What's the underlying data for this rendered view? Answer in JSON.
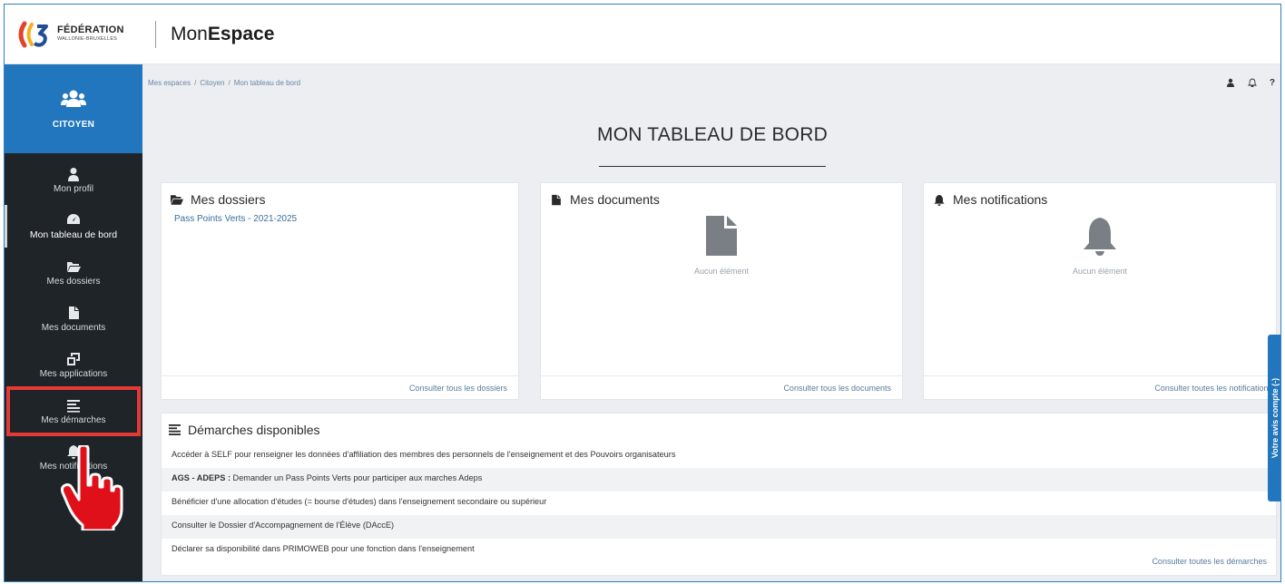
{
  "header": {
    "logo_line1": "FÉDÉRATION",
    "logo_line2": "WALLONIE-BRUXELLES",
    "app_title_light": "Mon",
    "app_title_bold": "Espace"
  },
  "sidebar": {
    "profile_label": "CITOYEN",
    "items": [
      {
        "label": "Mon profil",
        "icon": "user-icon"
      },
      {
        "label": "Mon tableau de bord",
        "icon": "dashboard-icon",
        "active": true
      },
      {
        "label": "Mes dossiers",
        "icon": "folder-icon"
      },
      {
        "label": "Mes documents",
        "icon": "document-icon"
      },
      {
        "label": "Mes applications",
        "icon": "windows-icon"
      },
      {
        "label": "Mes démarches",
        "icon": "list-icon",
        "highlighted": true
      },
      {
        "label": "Mes notifications",
        "icon": "bell-icon"
      }
    ]
  },
  "breadcrumb": [
    "Mes espaces",
    "Citoyen",
    "Mon tableau de bord"
  ],
  "topbar": {
    "help": "?"
  },
  "page_title": "MON TABLEAU DE BORD",
  "cards": {
    "dossiers": {
      "title": "Mes dossiers",
      "items": [
        "Pass Points Verts - 2021-2025"
      ],
      "footer": "Consulter tous les dossiers"
    },
    "documents": {
      "title": "Mes documents",
      "empty": "Aucun élément",
      "footer": "Consulter tous les documents"
    },
    "notifications": {
      "title": "Mes notifications",
      "empty": "Aucun élément",
      "footer": "Consulter toutes les notifications"
    }
  },
  "demarches": {
    "title": "Démarches disponibles",
    "rows": [
      {
        "bold": "",
        "text": "Accéder à SELF pour renseigner les données d'affiliation des membres des personnels de l'enseignement et des Pouvoirs organisateurs"
      },
      {
        "bold": "AGS - ADEPS :",
        "text": " Demander un Pass Points Verts pour participer aux marches Adeps"
      },
      {
        "bold": "",
        "text": "Bénéficier d'une allocation d'études (= bourse d'études) dans l'enseignement secondaire ou supérieur"
      },
      {
        "bold": "",
        "text": "Consulter le Dossier d'Accompagnement de l'Élève (DAccE)"
      },
      {
        "bold": "",
        "text": "Déclarer sa disponibilité dans PRIMOWEB pour une fonction dans l'enseignement"
      }
    ],
    "footer": "Consulter toutes les démarches"
  },
  "feedback_tab": "Votre avis compte (-)",
  "colors": {
    "accent_blue": "#2176bd",
    "sidebar_dark": "#1f2429",
    "highlight_red": "#e53935",
    "link_blue": "#3a6e9e"
  }
}
